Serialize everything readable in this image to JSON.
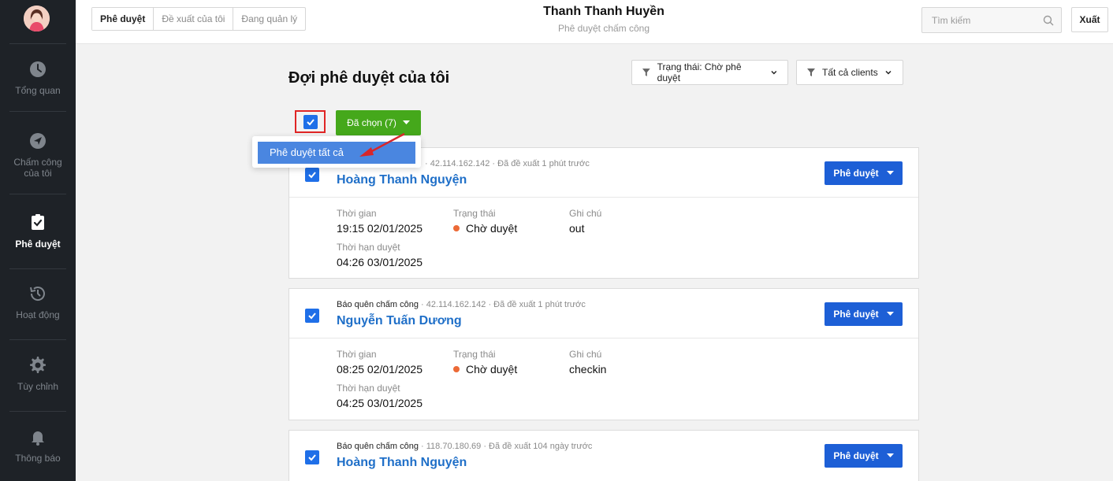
{
  "sidebar": {
    "avatar": "user-avatar",
    "items": [
      {
        "label": "Tổng quan",
        "icon": "clock-icon",
        "active": false
      },
      {
        "label": "Chấm công của tôi",
        "icon": "send-icon",
        "active": false
      },
      {
        "label": "Phê duyệt",
        "icon": "check-clipboard-icon",
        "active": true
      },
      {
        "label": "Hoạt động",
        "icon": "history-icon",
        "active": false
      },
      {
        "label": "Tùy chỉnh",
        "icon": "gear-icon",
        "active": false
      },
      {
        "label": "Thông báo",
        "icon": "bell-icon",
        "active": false
      }
    ]
  },
  "header": {
    "tabs": [
      {
        "label": "Phê duyệt",
        "active": true
      },
      {
        "label": "Đề xuất của tôi",
        "active": false
      },
      {
        "label": "Đang quản lý",
        "active": false
      }
    ],
    "user_name": "Thanh Thanh Huyền",
    "subtitle": "Phê duyệt chấm công",
    "search_placeholder": "Tìm kiếm",
    "export_label": "Xuất"
  },
  "main": {
    "heading": "Đợi phê duyệt của tôi",
    "filter_status": "Trạng thái: Chờ phê duyệt",
    "filter_clients": "Tất cả clients",
    "selected_label": "Đã chọn (7)",
    "dropdown_item": "Phê duyệt tất cả",
    "labels": {
      "time": "Thời gian",
      "status": "Trạng thái",
      "note": "Ghi chú",
      "deadline": "Thời hạn duyệt"
    },
    "approve_label": "Phê duyệt",
    "cards": [
      {
        "type": "",
        "meta": "· 42.114.162.142 · Đã đề xuất 1 phút trước",
        "name": "Hoàng Thanh Nguyện",
        "time": "19:15 02/01/2025",
        "status": "Chờ duyệt",
        "note": "out",
        "deadline": "04:26 03/01/2025"
      },
      {
        "type": "Báo quên chấm công",
        "meta": " · 42.114.162.142 · Đã đề xuất 1 phút trước",
        "name": "Nguyễn Tuấn Dương",
        "time": "08:25 02/01/2025",
        "status": "Chờ duyệt",
        "note": "checkin",
        "deadline": "04:25 03/01/2025"
      },
      {
        "type": "Báo quên chấm công",
        "meta": " · 118.70.180.69 · Đã đề xuất 104 ngày trước",
        "name": "Hoàng Thanh Nguyện"
      }
    ]
  },
  "colors": {
    "sidebar_bg": "#1e2227",
    "primary_blue": "#1d5fd6",
    "green": "#45a81b",
    "status_orange": "#e04a12",
    "highlight_red": "#e02525"
  }
}
